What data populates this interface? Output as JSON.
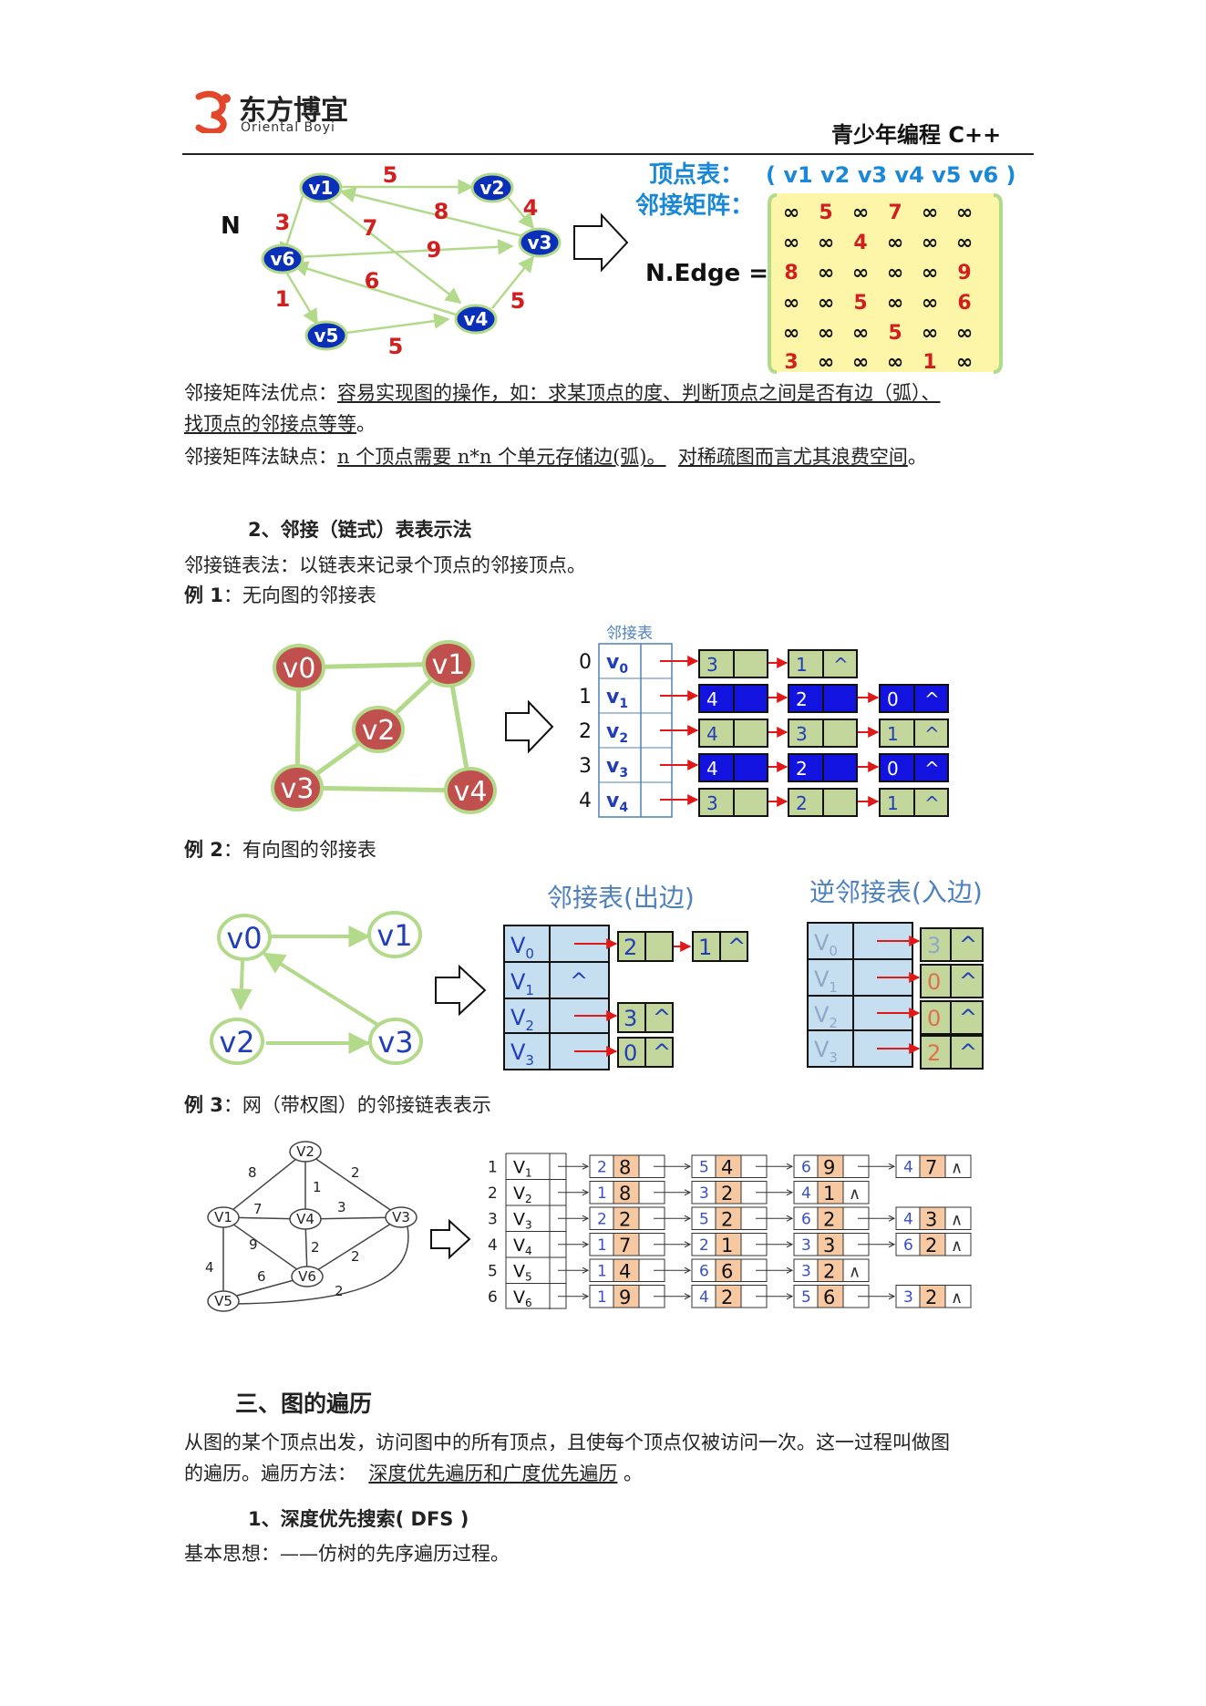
{
  "header": {
    "brand_cn": "东方博宜",
    "brand_en": "Oriental Boyi",
    "title_right": "青少年编程 C++"
  },
  "fig1": {
    "graph_name": "N",
    "nodes": [
      "v1",
      "v2",
      "v3",
      "v4",
      "v5",
      "v6"
    ],
    "edge_weights": [
      "5",
      "4",
      "8",
      "7",
      "9",
      "3",
      "6",
      "1",
      "5",
      "5"
    ],
    "vertex_label": "顶点表：",
    "vertex_list": "( v1 v2 v3 v4 v5 v6 )",
    "matrix_label": "邻接矩阵：",
    "edge_label": "N.Edge =",
    "matrix": [
      [
        "∞",
        "5",
        "∞",
        "7",
        "∞",
        "∞"
      ],
      [
        "∞",
        "∞",
        "4",
        "∞",
        "∞",
        "∞"
      ],
      [
        "8",
        "∞",
        "∞",
        "∞",
        "∞",
        "9"
      ],
      [
        "∞",
        "∞",
        "5",
        "∞",
        "∞",
        "6"
      ],
      [
        "∞",
        "∞",
        "∞",
        "5",
        "∞",
        "∞"
      ],
      [
        "3",
        "∞",
        "∞",
        "∞",
        "1",
        "∞"
      ]
    ]
  },
  "text": {
    "adv_prefix": "邻接矩阵法优点：",
    "adv_text_1": "容易实现图的操作，如：求某顶点的度、判断顶点之间是否有边（弧）、",
    "adv_text_2": "找顶点的邻接点等等",
    "adv_end": "。",
    "dis_prefix": "邻接矩阵法缺点：",
    "dis_text_1": "n 个顶点需要 n*n 个单元存储边(弧)。",
    "dis_text_2": "对稀疏图而言尤其浪费空间",
    "dis_end": "。",
    "section2_heading": "2、邻接（链式）表表示法",
    "adj_list_def": "邻接链表法：以链表来记录个顶点的邻接顶点。",
    "ex1_label": "例 1",
    "ex1_text": "：无向图的邻接表",
    "ex2_label": "例 2",
    "ex2_text": "：有向图的邻接表",
    "ex3_label": "例 3",
    "ex3_text": "：网（带权图）的邻接链表表示",
    "section3_heading": "三、图的遍历",
    "trav_line1": "从图的某个顶点出发，访问图中的所有顶点，且使每个顶点仅被访问一次。这一过程叫做图",
    "trav_line2_a": "的遍历。遍历方法：",
    "trav_line2_b": "深度优先遍历和广度优先遍历",
    "trav_line2_c": "。",
    "dfs_heading": "1、深度优先搜索( DFS )",
    "dfs_idea": "基本思想：——仿树的先序遍历过程。"
  },
  "fig2": {
    "nodes": [
      "v0",
      "v1",
      "v2",
      "v3",
      "v4"
    ],
    "table_title": "邻接表",
    "rows": [
      {
        "index": "0",
        "vertex": "v",
        "sub": "0",
        "list": [
          "3",
          "1"
        ],
        "blue": [
          false,
          false
        ]
      },
      {
        "index": "1",
        "vertex": "v",
        "sub": "1",
        "list": [
          "4",
          "2",
          "0"
        ],
        "blue": [
          true,
          true,
          false
        ]
      },
      {
        "index": "2",
        "vertex": "v",
        "sub": "2",
        "list": [
          "4",
          "3",
          "1"
        ],
        "blue": [
          false,
          false,
          false
        ]
      },
      {
        "index": "3",
        "vertex": "v",
        "sub": "3",
        "list": [
          "4",
          "2",
          "0"
        ],
        "blue": [
          true,
          true,
          false
        ]
      },
      {
        "index": "4",
        "vertex": "v",
        "sub": "4",
        "list": [
          "3",
          "2",
          "1"
        ],
        "blue": [
          false,
          false,
          false
        ]
      }
    ],
    "null_mark": "^"
  },
  "fig3": {
    "nodes": [
      "v0",
      "v1",
      "v2",
      "v3"
    ],
    "out_title": "邻接表(出边)",
    "in_title": "逆邻接表(入边)",
    "out_rows": [
      {
        "vertex": "V",
        "sub": "0",
        "list": [
          "2",
          "1"
        ]
      },
      {
        "vertex": "V",
        "sub": "1",
        "list": []
      },
      {
        "vertex": "V",
        "sub": "2",
        "list": [
          "3"
        ]
      },
      {
        "vertex": "V",
        "sub": "3",
        "list": [
          "0"
        ]
      }
    ],
    "in_rows": [
      {
        "vertex": "V",
        "sub": "0",
        "list": [
          "3"
        ]
      },
      {
        "vertex": "V",
        "sub": "1",
        "list": [
          "0"
        ]
      },
      {
        "vertex": "V",
        "sub": "2",
        "list": [
          "0"
        ]
      },
      {
        "vertex": "V",
        "sub": "3",
        "list": [
          "2"
        ]
      }
    ],
    "null_mark": "^"
  },
  "fig4": {
    "nodes": [
      "V1",
      "V2",
      "V3",
      "V4",
      "V5",
      "V6"
    ],
    "edge_weights": [
      "8",
      "2",
      "1",
      "7",
      "3",
      "9",
      "2",
      "2",
      "4",
      "6",
      "2"
    ],
    "rows": [
      {
        "index": "1",
        "vertex": "V",
        "sub": "1",
        "list": [
          [
            "2",
            "8"
          ],
          [
            "5",
            "4"
          ],
          [
            "6",
            "9"
          ],
          [
            "4",
            "7"
          ]
        ]
      },
      {
        "index": "2",
        "vertex": "V",
        "sub": "2",
        "list": [
          [
            "1",
            "8"
          ],
          [
            "3",
            "2"
          ],
          [
            "4",
            "1"
          ]
        ]
      },
      {
        "index": "3",
        "vertex": "V",
        "sub": "3",
        "list": [
          [
            "2",
            "2"
          ],
          [
            "5",
            "2"
          ],
          [
            "6",
            "2"
          ],
          [
            "4",
            "3"
          ]
        ]
      },
      {
        "index": "4",
        "vertex": "V",
        "sub": "4",
        "list": [
          [
            "1",
            "7"
          ],
          [
            "2",
            "1"
          ],
          [
            "3",
            "3"
          ],
          [
            "6",
            "2"
          ]
        ]
      },
      {
        "index": "5",
        "vertex": "V",
        "sub": "5",
        "list": [
          [
            "1",
            "4"
          ],
          [
            "6",
            "6"
          ],
          [
            "3",
            "2"
          ]
        ]
      },
      {
        "index": "6",
        "vertex": "V",
        "sub": "6",
        "list": [
          [
            "1",
            "9"
          ],
          [
            "4",
            "2"
          ],
          [
            "5",
            "6"
          ],
          [
            "3",
            "2"
          ]
        ]
      }
    ],
    "null_mark": "∧"
  }
}
